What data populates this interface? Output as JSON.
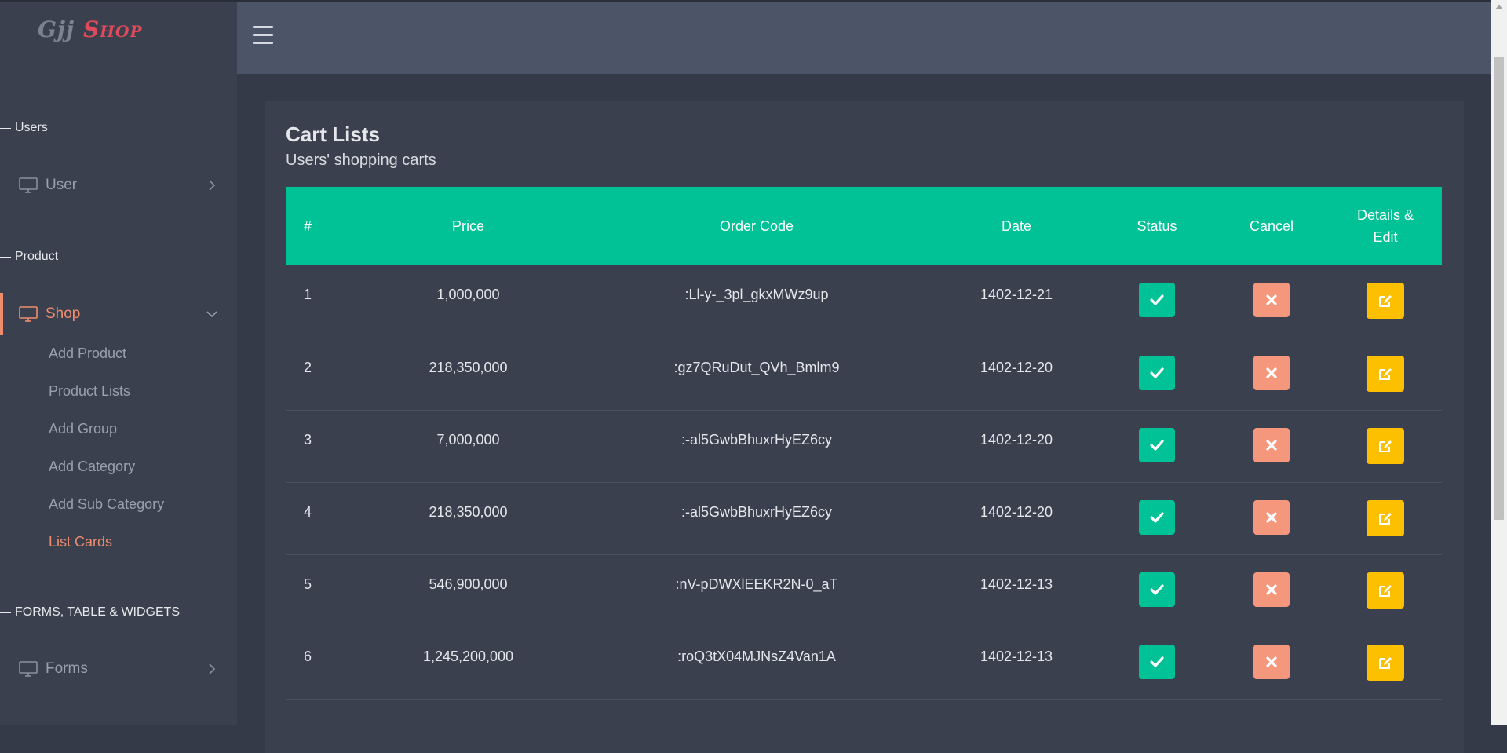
{
  "sidebar": {
    "logo_part1": "Gjj",
    "logo_part2": "Shop",
    "sections": {
      "users": "Users",
      "product": "Product",
      "forms": "FORMS, TABLE & WIDGETS"
    },
    "nav": {
      "user": "User",
      "shop": "Shop",
      "forms": "Forms"
    },
    "shop_items": [
      "Add Product",
      "Product Lists",
      "Add Group",
      "Add Category",
      "Add Sub Category",
      "List Cards"
    ],
    "active_sub_item": "List Cards"
  },
  "card": {
    "title": "Cart Lists",
    "subtitle": "Users' shopping carts"
  },
  "table": {
    "headers": {
      "num": "#",
      "price": "Price",
      "order_code": "Order Code",
      "date": "Date",
      "status": "Status",
      "cancel": "Cancel",
      "details_line1": "Details &",
      "details_line2": "Edit"
    },
    "rows": [
      {
        "num": "1",
        "price": "1,000,000",
        "order_code": ":Ll-y-_3pl_gkxMWz9up",
        "date": "1402-12-21"
      },
      {
        "num": "2",
        "price": "218,350,000",
        "order_code": ":gz7QRuDut_QVh_Bmlm9",
        "date": "1402-12-20"
      },
      {
        "num": "3",
        "price": "7,000,000",
        "order_code": ":-al5GwbBhuxrHyEZ6cy",
        "date": "1402-12-20"
      },
      {
        "num": "4",
        "price": "218,350,000",
        "order_code": ":-al5GwbBhuxrHyEZ6cy",
        "date": "1402-12-20"
      },
      {
        "num": "5",
        "price": "546,900,000",
        "order_code": ":nV-pDWXlEEKR2N-0_aT",
        "date": "1402-12-13"
      },
      {
        "num": "6",
        "price": "1,245,200,000",
        "order_code": ":roQ3tX04MJNsZ4Van1A",
        "date": "1402-12-13"
      }
    ]
  },
  "icons": {
    "menu": "hamburger-icon",
    "nav": "monitor-icon",
    "status": "check-icon",
    "cancel": "close-icon",
    "edit": "edit-icon"
  },
  "colors": {
    "accent": "#f08c6e",
    "table_header": "#00c296",
    "status_button": "#00c296",
    "cancel_button": "#f5977c",
    "edit_button": "#fdc000",
    "logo_red": "#e14a5a"
  }
}
